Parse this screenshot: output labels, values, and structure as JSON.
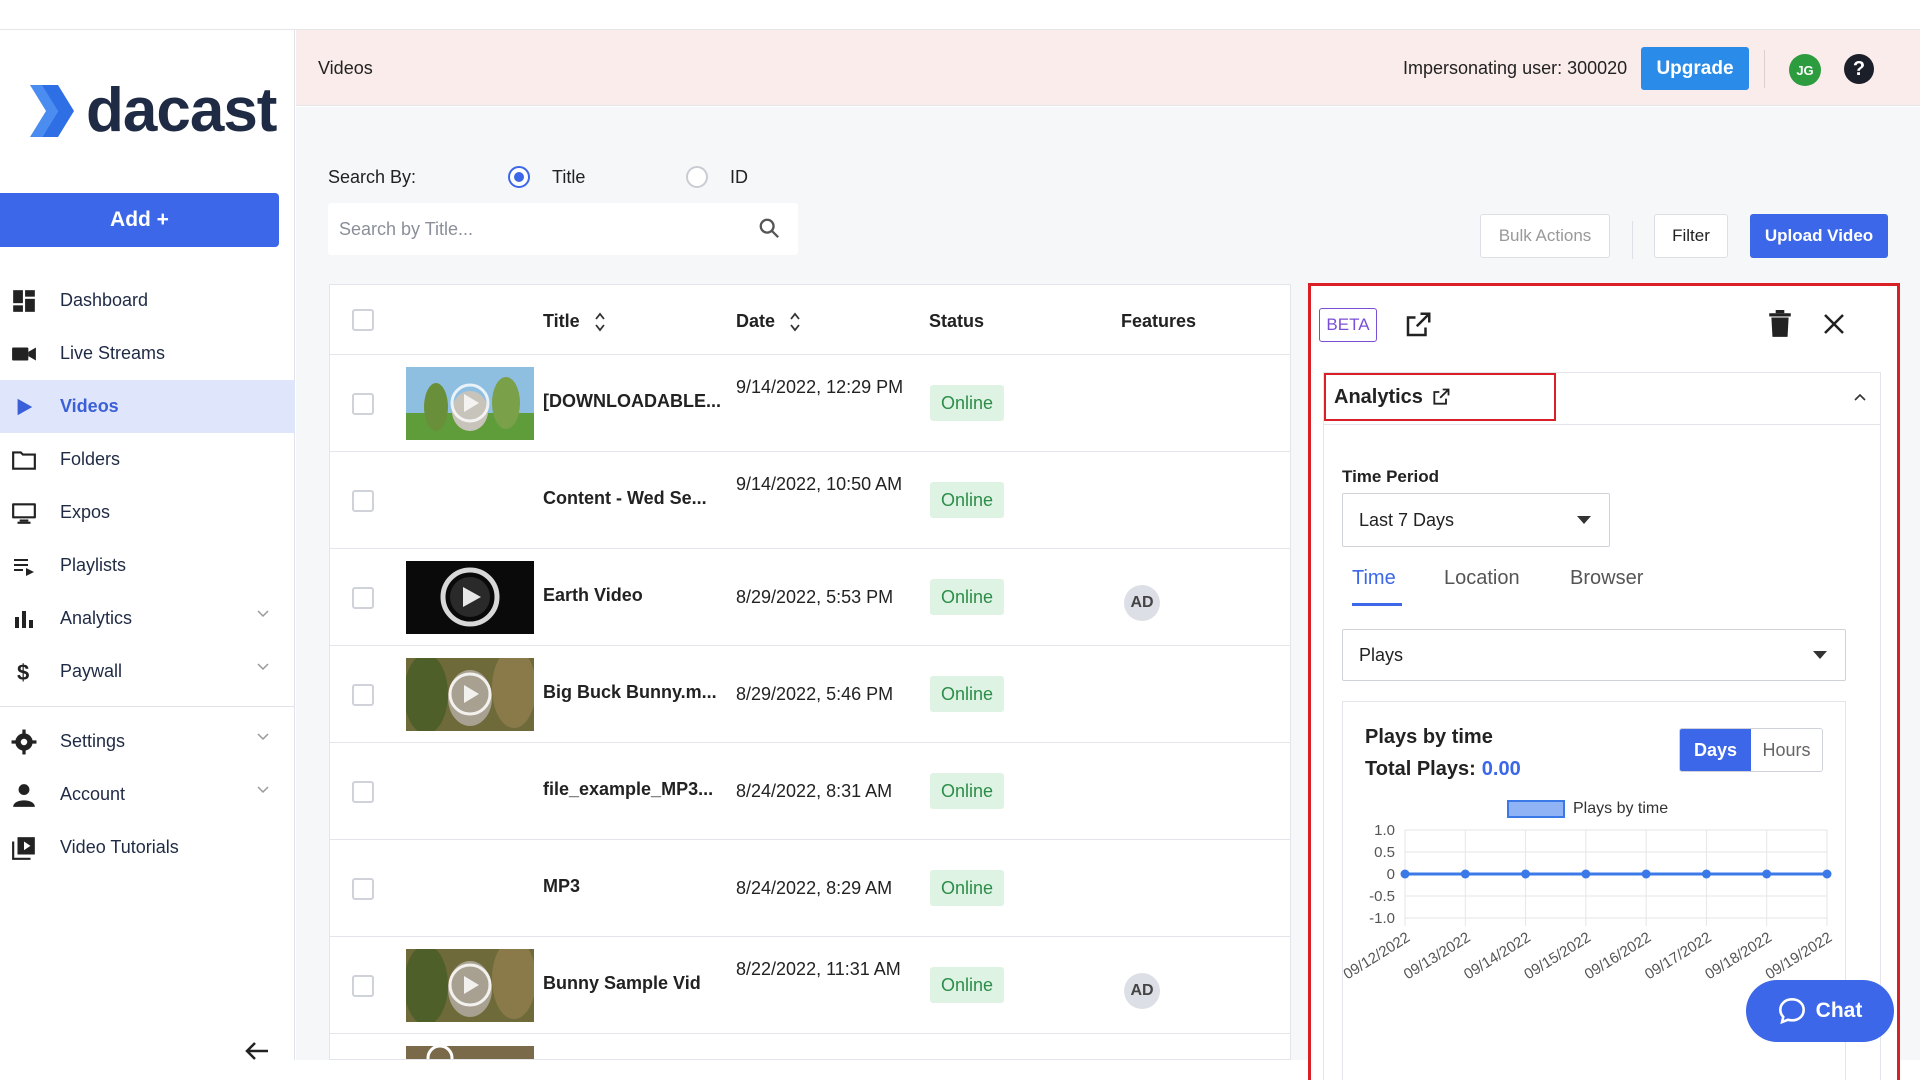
{
  "brand": {
    "name": "dacast"
  },
  "sidebar": {
    "add_label": "Add +",
    "items": [
      {
        "label": "Dashboard",
        "icon": "dashboard-icon"
      },
      {
        "label": "Live Streams",
        "icon": "video-camera-icon"
      },
      {
        "label": "Videos",
        "icon": "play-icon",
        "active": true
      },
      {
        "label": "Folders",
        "icon": "folder-icon"
      },
      {
        "label": "Expos",
        "icon": "monitor-icon"
      },
      {
        "label": "Playlists",
        "icon": "playlist-icon"
      },
      {
        "label": "Analytics",
        "icon": "bar-chart-icon",
        "expandable": true
      },
      {
        "label": "Paywall",
        "icon": "dollar-icon",
        "expandable": true
      }
    ],
    "items_bottom": [
      {
        "label": "Settings",
        "icon": "gear-icon",
        "expandable": true
      },
      {
        "label": "Account",
        "icon": "person-icon",
        "expandable": true
      },
      {
        "label": "Video Tutorials",
        "icon": "video-library-icon"
      }
    ]
  },
  "header": {
    "title": "Videos",
    "impersonating": "Impersonating user: 300020",
    "upgrade_label": "Upgrade",
    "avatar_initials": "JG",
    "help_label": "?"
  },
  "search": {
    "search_by_label": "Search By:",
    "option_title": "Title",
    "option_id": "ID",
    "selected": "Title",
    "placeholder": "Search by Title..."
  },
  "toolbar": {
    "bulk_actions": "Bulk Actions",
    "filter": "Filter",
    "upload": "Upload Video"
  },
  "table": {
    "columns": [
      "Title",
      "Date",
      "Status",
      "Features"
    ],
    "rows": [
      {
        "title": "[DOWNLOADABLE...",
        "date": "9/14/2022, 12:29 PM",
        "status": "Online",
        "feature": "",
        "thumb": "bunny"
      },
      {
        "title": "Content - Wed Se...",
        "date": "9/14/2022, 10:50 AM",
        "status": "Online",
        "feature": "",
        "thumb": ""
      },
      {
        "title": "Earth Video",
        "date": "8/29/2022, 5:53 PM",
        "status": "Online",
        "feature": "AD",
        "thumb": "dark"
      },
      {
        "title": "Big Buck Bunny.m...",
        "date": "8/29/2022, 5:46 PM",
        "status": "Online",
        "feature": "",
        "thumb": "bunny2"
      },
      {
        "title": "file_example_MP3...",
        "date": "8/24/2022, 8:31 AM",
        "status": "Online",
        "feature": "",
        "thumb": ""
      },
      {
        "title": "MP3",
        "date": "8/24/2022, 8:29 AM",
        "status": "Online",
        "feature": "",
        "thumb": ""
      },
      {
        "title": "Bunny Sample Vid",
        "date": "8/22/2022, 11:31 AM",
        "status": "Online",
        "feature": "AD",
        "thumb": "bunny2"
      }
    ]
  },
  "panel": {
    "beta_label": "BETA",
    "card_title": "Analytics",
    "time_period_label": "Time Period",
    "time_period_value": "Last 7 Days",
    "tabs": [
      "Time",
      "Location",
      "Browser"
    ],
    "active_tab": "Time",
    "metric_value": "Plays",
    "chart_title": "Plays by time",
    "total_label": "Total Plays:",
    "total_value": "0.00",
    "toggle_days": "Days",
    "toggle_hours": "Hours",
    "toggle_selected": "Days"
  },
  "chart_data": {
    "type": "line",
    "title": "Plays by time",
    "x": [
      "09/12/2022",
      "09/13/2022",
      "09/14/2022",
      "09/15/2022",
      "09/16/2022",
      "09/17/2022",
      "09/18/2022",
      "09/19/2022"
    ],
    "series": [
      {
        "name": "Plays by time",
        "values": [
          0,
          0,
          0,
          0,
          0,
          0,
          0,
          0
        ]
      }
    ],
    "yticks": [
      1.0,
      0.5,
      0,
      -0.5,
      -1.0
    ],
    "ytick_labels": [
      "1.0",
      "0.5",
      "0",
      "-0.5",
      "-1.0"
    ],
    "ylim": [
      -1.0,
      1.0
    ],
    "grid": true,
    "legend": "top",
    "colors": {
      "line": "#3b78e8",
      "fill": "#8fb3f5"
    }
  },
  "chat": {
    "label": "Chat"
  },
  "colors": {
    "accent": "#3b67e8",
    "upgrade": "#2a8be8",
    "online_bg": "#dff3e4",
    "online_text": "#2c8d48",
    "highlight": "#d92027",
    "header_bg": "#fbecec"
  }
}
